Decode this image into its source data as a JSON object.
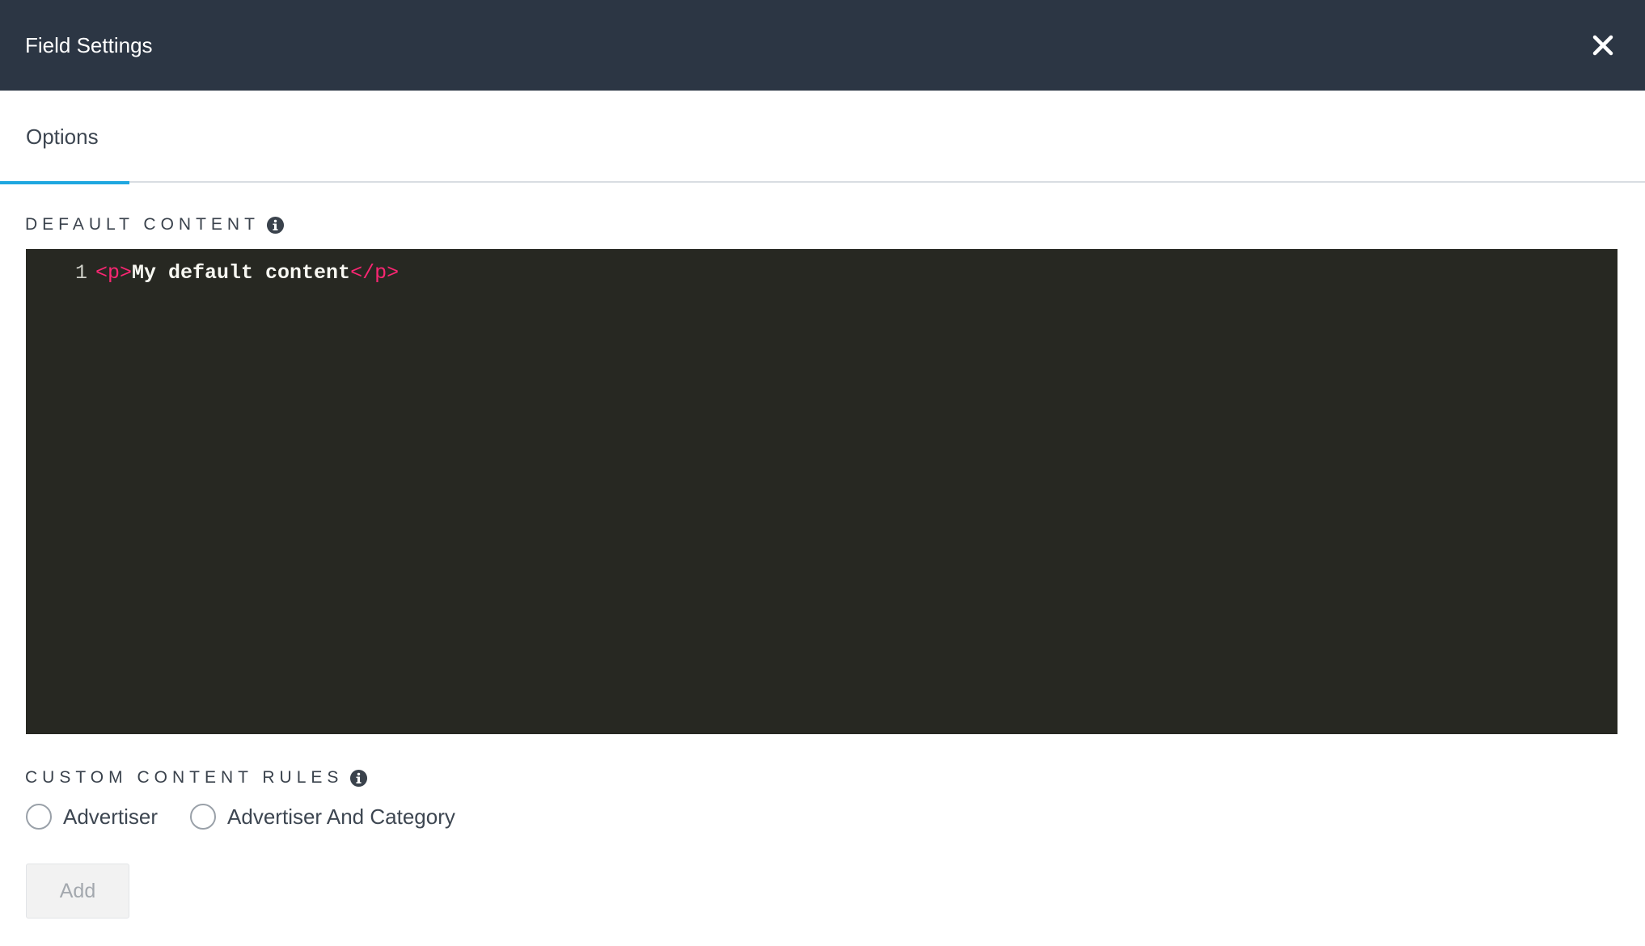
{
  "header": {
    "title": "Field Settings",
    "close_icon": "close-icon"
  },
  "tabs": [
    {
      "label": "Options",
      "active": true
    }
  ],
  "default_content": {
    "label": "DEFAULT CONTENT",
    "info_icon": "info-icon",
    "editor": {
      "line_number": "1",
      "open_tag": "<p>",
      "text": "My default content",
      "close_tag": "</p>"
    }
  },
  "custom_rules": {
    "label": "CUSTOM CONTENT RULES",
    "info_icon": "info-icon",
    "options": [
      {
        "label": "Advertiser",
        "selected": false
      },
      {
        "label": "Advertiser And Category",
        "selected": false
      }
    ],
    "add_label": "Add"
  },
  "colors": {
    "header_bg": "#2c3644",
    "tab_accent": "#1fa7e0",
    "editor_bg": "#272822",
    "tag_color": "#f92672",
    "code_text": "#f8f8f2"
  }
}
